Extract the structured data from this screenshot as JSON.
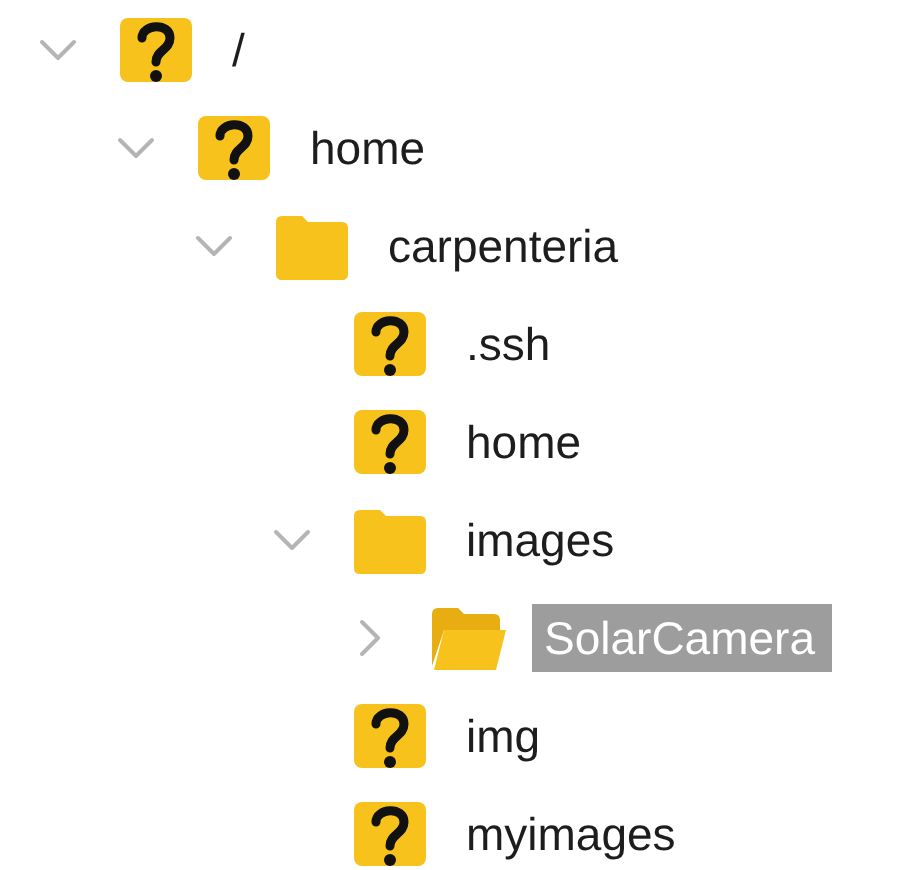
{
  "tree": [
    {
      "label": "/",
      "kind": "unknown",
      "expanded": true,
      "selected": false,
      "children": [
        {
          "label": "home",
          "kind": "unknown",
          "expanded": true,
          "selected": false,
          "children": [
            {
              "label": "carpenteria",
              "kind": "folder",
              "expanded": true,
              "selected": false,
              "children": [
                {
                  "label": ".ssh",
                  "kind": "unknown",
                  "selected": false
                },
                {
                  "label": "home",
                  "kind": "unknown",
                  "selected": false
                },
                {
                  "label": "images",
                  "kind": "folder",
                  "expanded": true,
                  "selected": false,
                  "children": [
                    {
                      "label": "SolarCamera",
                      "kind": "folder-open",
                      "expanded": false,
                      "selected": true
                    }
                  ]
                },
                {
                  "label": "img",
                  "kind": "unknown",
                  "selected": false
                },
                {
                  "label": "myimages",
                  "kind": "unknown",
                  "selected": false
                }
              ]
            }
          ]
        }
      ]
    }
  ]
}
